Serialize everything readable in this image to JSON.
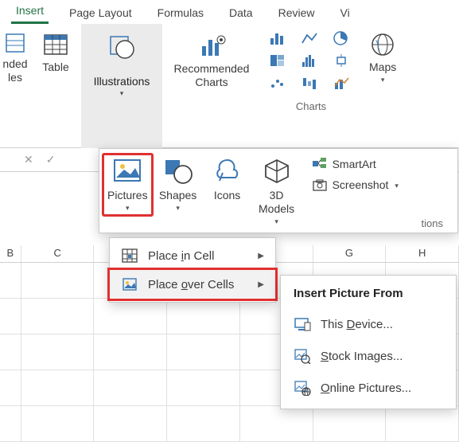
{
  "tabs": [
    "Insert",
    "Page Layout",
    "Formulas",
    "Data",
    "Review",
    "Vi"
  ],
  "active_tab": 0,
  "ribbon": {
    "recommended_tables_label": "nded\nles",
    "table_label": "Table",
    "illustrations_label": "Illustrations",
    "recommended_charts_label": "Recommended\nCharts",
    "charts_group_label": "Charts",
    "maps_label": "Maps"
  },
  "illus_popup": {
    "pictures_label": "Pictures",
    "shapes_label": "Shapes",
    "icons_label": "Icons",
    "models_label": "3D\nModels",
    "smartart_label": "SmartArt",
    "screenshot_label": "Screenshot",
    "tions_fragment": "tions"
  },
  "sub_menu": {
    "place_in_cell": "Place in Cell",
    "place_over_cells": "Place over Cells"
  },
  "flyout": {
    "title": "Insert Picture From",
    "this_device": "This Device...",
    "stock_images": "Stock Images...",
    "online_pictures": "Online Pictures..."
  },
  "columns": [
    "B",
    "C",
    "",
    "",
    "",
    "G",
    "H"
  ],
  "colors": {
    "accent": "#217346",
    "icon_blue": "#3b78b4",
    "highlight": "#e03030"
  }
}
